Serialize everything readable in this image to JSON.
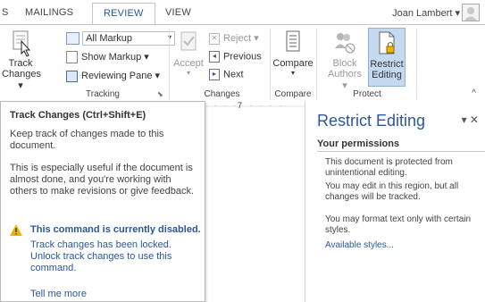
{
  "tabs": [
    {
      "label": "S"
    },
    {
      "label": "MAILINGS"
    },
    {
      "label": "REVIEW"
    },
    {
      "label": "VIEW"
    }
  ],
  "user": {
    "name": "Joan Lambert",
    "caret": "▾"
  },
  "ribbon": {
    "tracking": {
      "label": "Tracking",
      "track_changes": {
        "line1": "Track",
        "line2": "Changes ▾"
      },
      "markup_select": "All Markup",
      "show_markup": "Show Markup ▾",
      "reviewing_pane": "Reviewing Pane ▾"
    },
    "changes": {
      "label": "Changes",
      "accept": "Accept",
      "reject": "Reject ▾",
      "previous": "Previous",
      "next": "Next"
    },
    "compare": {
      "label": "Compare",
      "button": "Compare"
    },
    "protect": {
      "label": "Protect",
      "block_authors": {
        "line1": "Block",
        "line2": "Authors ▾"
      },
      "restrict_editing": {
        "line1": "Restrict",
        "line2": "Editing"
      }
    }
  },
  "tooltip": {
    "title": "Track Changes (Ctrl+Shift+E)",
    "p1": "Keep track of changes made to this document.",
    "p2": "This is especially useful if the document is almost done, and you're working with others to make revisions or give feedback.",
    "warning_title": "This command is currently disabled.",
    "warning_body": "Track changes has been locked. Unlock track changes to use this command.",
    "tell_me_more": "Tell me more"
  },
  "ruler": {
    "mark": "7"
  },
  "pane": {
    "title": "Restrict Editing",
    "controls": "▾ ✕",
    "permissions_heading": "Your permissions",
    "p1": "This document is protected from unintentional editing.",
    "p2": "You may edit in this region, but all changes will be tracked.",
    "p3": "You may format text only with certain styles.",
    "link": "Available styles..."
  },
  "colors": {
    "accent": "#2b579a",
    "highlight": "#c5d9f1",
    "warning": "#f0b400"
  }
}
